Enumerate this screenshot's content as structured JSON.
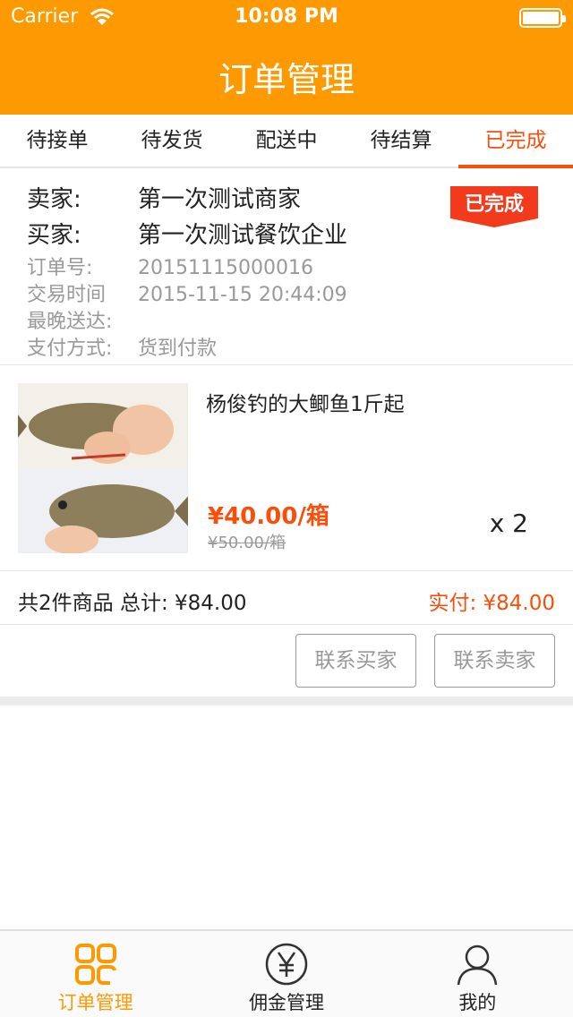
{
  "status_bar": {
    "carrier": "Carrier",
    "time": "10:08 PM"
  },
  "header": {
    "title": "订单管理"
  },
  "tabs": [
    {
      "label": "待接单"
    },
    {
      "label": "待发货"
    },
    {
      "label": "配送中"
    },
    {
      "label": "待结算"
    },
    {
      "label": "已完成",
      "active": true
    }
  ],
  "order": {
    "seller_label": "卖家:",
    "seller": "第一次测试商家",
    "buyer_label": "买家:",
    "buyer": "第一次测试餐饮企业",
    "order_no_label": "订单号:",
    "order_no": "20151115000016",
    "trade_time_label": "交易时间",
    "trade_time": "2015-11-15 20:44:09",
    "latest_delivery_label": "最晚送达:",
    "latest_delivery": "",
    "payment_label": "支付方式:",
    "payment": "货到付款",
    "status_stamp": "已完成"
  },
  "product": {
    "name": "杨俊钓的大鲫鱼1斤起",
    "price": "¥40.00/箱",
    "original_price": "¥50.00/箱",
    "quantity": "x 2",
    "image_icon": "fish-photo"
  },
  "summary": {
    "total": "共2件商品 总计: ¥84.00",
    "paid": "实付: ¥84.00"
  },
  "actions": {
    "contact_buyer": "联系买家",
    "contact_seller": "联系卖家"
  },
  "tabbar": [
    {
      "label": "订单管理",
      "icon": "grid-icon",
      "active": true
    },
    {
      "label": "佣金管理",
      "icon": "yen-circle-icon"
    },
    {
      "label": "我的",
      "icon": "person-icon"
    }
  ],
  "colors": {
    "accent": "#fd9a02",
    "highlight": "#fa4e0b"
  }
}
